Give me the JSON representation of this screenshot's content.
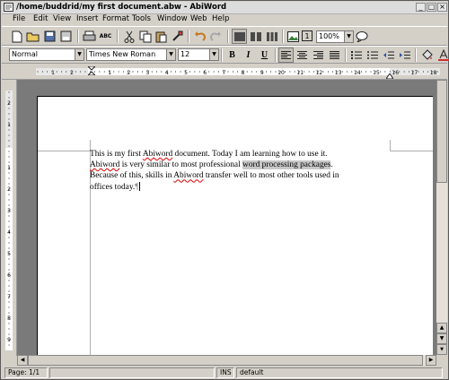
{
  "window": {
    "title": "/home/buddrid/my first document.abw - AbiWord"
  },
  "menu": [
    "File",
    "Edit",
    "View",
    "Insert",
    "Format",
    "Tools",
    "Window",
    "Web",
    "Help"
  ],
  "toolbar": {
    "zoom": "100%",
    "style": "Normal",
    "font": "Times New Roman",
    "size": "12",
    "bold": "B",
    "italic": "I",
    "underline": "U",
    "spell_check_label": "ABC"
  },
  "ruler": {
    "h_labels": [
      "1",
      "2",
      "1",
      "2",
      "3",
      "4",
      "5",
      "6",
      "7",
      "8",
      "9",
      "10",
      "11",
      "12",
      "13",
      "14",
      "15",
      "16",
      "17",
      "18"
    ],
    "v_labels": [
      "2",
      "1",
      "1",
      "2",
      "3",
      "4",
      "5",
      "6",
      "7",
      "8",
      "9"
    ]
  },
  "document": {
    "t1": "This is my first ",
    "e1": "Abiword",
    "t2": " document.  Today I am learning how to use it.  ",
    "e2": "Abiword",
    "t3": " is very similar to most professional ",
    "h1": "word processing packages",
    "t4": ".  Because of this, skills in ",
    "e3": "Abiword",
    "t5": " transfer well to most other tools used in offices today.",
    "pilcrow": "¶"
  },
  "status": {
    "page": "Page: 1/1",
    "mode": "INS",
    "lang": "default"
  }
}
